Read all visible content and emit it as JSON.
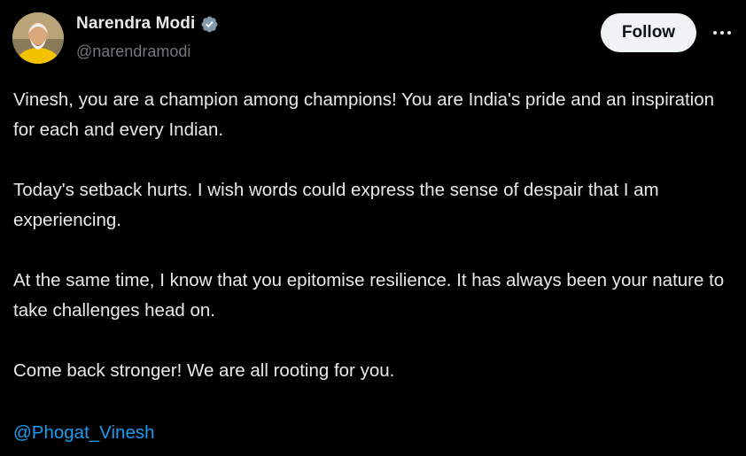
{
  "author": {
    "display_name": "Narendra Modi",
    "handle": "@narendramodi",
    "verified": true
  },
  "actions": {
    "follow_label": "Follow",
    "more_icon": "more-horizontal-icon"
  },
  "tweet": {
    "paragraphs": [
      "Vinesh, you are a champion among champions! You are India's pride and an inspiration for each and every Indian.",
      "Today's setback hurts. I wish words could express the sense of despair that I am experiencing.",
      "At the same time, I know that you epitomise resilience. It has always been your nature to take challenges head on.",
      "Come back stronger! We are all rooting for you."
    ],
    "mention": "@Phogat_Vinesh"
  },
  "colors": {
    "background": "#000000",
    "text": "#e7e9ea",
    "muted": "#71767b",
    "link": "#1d9bf0",
    "verified": "#829aab",
    "follow_bg": "#eff3f4"
  }
}
